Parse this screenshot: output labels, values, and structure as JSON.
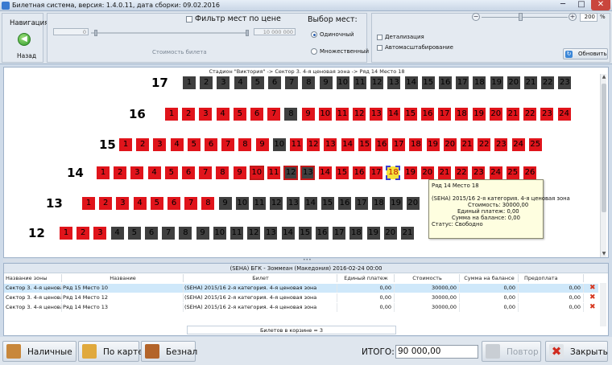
{
  "window": {
    "title": "Билетная система, версия: 1.4.0.11, дата сборки: 09.02.2016",
    "min": "─",
    "max": "□",
    "close": "✕"
  },
  "navigation": {
    "title": "Навигация",
    "back_label": "Назад",
    "back_icon": "arrow-left-icon"
  },
  "price_filter": {
    "label": "Фильтр мест по цене",
    "checked": false,
    "min_value": "0",
    "max_value": "10 000 000",
    "caption": "Стоимость билета"
  },
  "seat_selection": {
    "title": "Выбор мест:",
    "options": [
      {
        "label": "Одиночный",
        "selected": true
      },
      {
        "label": "Множественный",
        "selected": false
      }
    ]
  },
  "view_options": {
    "detail_label": "Детализация",
    "autoscale_label": "Автомасштабирование",
    "refresh_label": "Обновить",
    "zoom_minus": "−",
    "zoom_plus": "+",
    "zoom_value": "200",
    "zoom_unit": "%"
  },
  "hall": {
    "path": "Стадион \"Виктория\" -> Сектор 3. 4-я ценовая зона -> Ряд 14 Место 18",
    "colors": {
      "free": "#e0141b",
      "sold": "#3f3f3f"
    },
    "rows": [
      {
        "number": "17",
        "first_seat": 1,
        "seats": [
          "1",
          "2",
          "3",
          "4",
          "5",
          "6",
          "7",
          "8",
          "9",
          "10",
          "11",
          "12",
          "13",
          "14",
          "15",
          "16",
          "17",
          "18",
          "19",
          "20",
          "21",
          "22",
          "23"
        ],
        "sold": [
          "1",
          "2",
          "3",
          "4",
          "5",
          "6",
          "7",
          "8",
          "9",
          "10",
          "11",
          "12",
          "13",
          "14",
          "15",
          "16",
          "17",
          "18",
          "19",
          "20",
          "21",
          "22",
          "23"
        ],
        "selected": [],
        "current": []
      },
      {
        "number": "16",
        "first_seat": 1,
        "seats": [
          "1",
          "2",
          "3",
          "4",
          "5",
          "6",
          "7",
          "8",
          "9",
          "10",
          "11",
          "12",
          "13",
          "14",
          "15",
          "16",
          "17",
          "18",
          "19",
          "20",
          "21",
          "22",
          "23",
          "24"
        ],
        "sold": [
          "8"
        ],
        "selected": [],
        "current": []
      },
      {
        "number": "15",
        "first_seat": 1,
        "seats": [
          "1",
          "2",
          "3",
          "4",
          "5",
          "6",
          "7",
          "8",
          "9",
          "10",
          "11",
          "12",
          "13",
          "14",
          "15",
          "16",
          "17",
          "18",
          "19",
          "20",
          "21",
          "22",
          "23",
          "24",
          "25"
        ],
        "sold": [
          "10"
        ],
        "selected": [],
        "current": []
      },
      {
        "number": "14",
        "first_seat": 1,
        "seats": [
          "1",
          "2",
          "3",
          "4",
          "5",
          "6",
          "7",
          "8",
          "9",
          "10",
          "11",
          "12",
          "13",
          "14",
          "15",
          "16",
          "17",
          "18",
          "19",
          "20",
          "21",
          "22",
          "23",
          "24",
          "25",
          "26"
        ],
        "sold": [
          "12",
          "13"
        ],
        "selected": [
          "10",
          "12",
          "13"
        ],
        "current": [
          "18"
        ]
      },
      {
        "number": "13",
        "first_seat": 1,
        "seats": [
          "1",
          "2",
          "3",
          "4",
          "5",
          "6",
          "7",
          "8",
          "9",
          "10",
          "11",
          "12",
          "13",
          "14",
          "15",
          "16",
          "17",
          "18",
          "19",
          "20",
          "21",
          "22",
          "23",
          "24",
          "25",
          "26"
        ],
        "sold": [
          "9",
          "10",
          "11",
          "12",
          "13",
          "14",
          "15",
          "16",
          "17",
          "18",
          "19",
          "20",
          "21",
          "22"
        ],
        "selected": [],
        "current": []
      },
      {
        "number": "12",
        "first_seat": 1,
        "seats": [
          "1",
          "2",
          "3",
          "4",
          "5",
          "6",
          "7",
          "8",
          "9",
          "10",
          "11",
          "12",
          "13",
          "14",
          "15",
          "16",
          "17",
          "18",
          "19",
          "20",
          "21",
          "22",
          "23",
          "24",
          "25",
          "26"
        ],
        "sold": [
          "4",
          "5",
          "6",
          "7",
          "8",
          "9",
          "10",
          "11",
          "12",
          "13",
          "14",
          "15",
          "16",
          "17",
          "18",
          "19",
          "20",
          "21",
          "22",
          "23",
          "24",
          "25",
          "26"
        ],
        "selected": [],
        "current": []
      }
    ]
  },
  "tooltip": {
    "title": "Ряд 14 Место 18",
    "category": "(SEHA) 2015/16 2-я категория. 4-я ценовая зона",
    "price": "Стоимость: 30000,00",
    "single_payment": "Единый платеж: 0,00",
    "balance": "Сумма на балансе: 0,00",
    "status": "Статус: Свободно"
  },
  "cart": {
    "title": "(SEHA) БГК - Зоммеан (Македония) 2016-02-24 00:00",
    "columns": [
      "Название зоны",
      "Название",
      "Билет",
      "Единый платеж",
      "Стоимость",
      "Сумма на балансе",
      "Предоплата"
    ],
    "rows": [
      {
        "zone": "Сектор 3. 4-я ценовая...",
        "name": "Ряд 15 Место 10",
        "ticket": "(SEHA) 2015/16 2-я категория. 4-я ценовая зона",
        "single": "0,00",
        "price": "30000,00",
        "balance": "0,00",
        "prepay": "0,00"
      },
      {
        "zone": "Сектор 3. 4-я ценовая...",
        "name": "Ряд 14 Место 12",
        "ticket": "(SEHA) 2015/16 2-я категория. 4-я ценовая зона",
        "single": "0,00",
        "price": "30000,00",
        "balance": "0,00",
        "prepay": "0,00"
      },
      {
        "zone": "Сектор 3. 4-я ценовая...",
        "name": "Ряд 14 Место 13",
        "ticket": "(SEHA) 2015/16 2-я категория. 4-я ценовая зона",
        "single": "0,00",
        "price": "30000,00",
        "balance": "0,00",
        "prepay": "0,00"
      }
    ],
    "delete_icon": "delete-x-icon",
    "count_text": "Билетов в корзине = 3"
  },
  "footer": {
    "cash_label": "Наличные",
    "card_label": "По карте",
    "noncash_label": "Безнал",
    "total_label": "ИТОГО:",
    "total_value": "90 000,00",
    "repeat_label": "Повтор",
    "close_label": "Закрыть"
  }
}
